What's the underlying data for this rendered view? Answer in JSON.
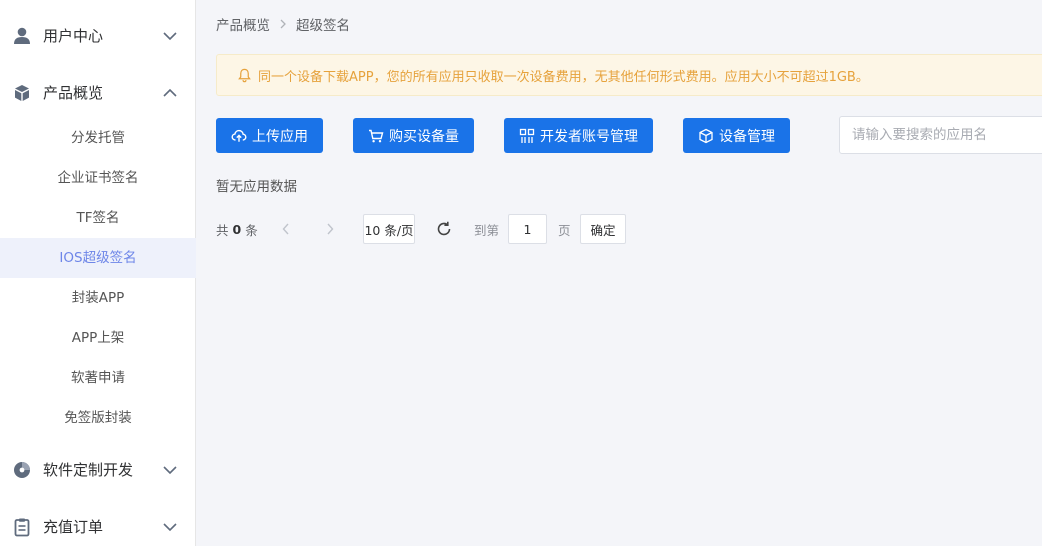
{
  "sidebar": {
    "groups": [
      {
        "label": "用户中心",
        "icon": "user-icon",
        "expanded": false
      },
      {
        "label": "产品概览",
        "icon": "cube-icon",
        "expanded": true
      },
      {
        "label": "软件定制开发",
        "icon": "pie-chart-icon",
        "expanded": false
      },
      {
        "label": "充值订单",
        "icon": "clipboard-icon",
        "expanded": false
      }
    ],
    "sub_items": [
      "分发托管",
      "企业证书签名",
      "TF签名",
      "IOS超级签名",
      "封装APP",
      "APP上架",
      "软著申请",
      "免签版封装"
    ],
    "active_item": "IOS超级签名"
  },
  "breadcrumb": {
    "parent": "产品概览",
    "current": "超级签名"
  },
  "notice": {
    "text": "同一个设备下载APP，您的所有应用只收取一次设备费用，无其他任何形式费用。应用大小不可超过1GB。"
  },
  "toolbar": {
    "upload_label": "上传应用",
    "buy_label": "购买设备量",
    "dev_account_label": "开发者账号管理",
    "device_mgmt_label": "设备管理",
    "search_placeholder": "请输入要搜索的应用名"
  },
  "empty_text": "暂无应用数据",
  "pagination": {
    "total_prefix": "共",
    "total_count": "0",
    "total_suffix": "条",
    "page_size": "10 条/页",
    "goto_label": "到第",
    "page_value": "1",
    "page_suffix": "页",
    "confirm_label": "确定"
  },
  "colors": {
    "primary": "#1a73e8",
    "active_text": "#6e86e8",
    "active_bg": "#eef1fb",
    "notice_bg": "#fdf6e6",
    "notice_text": "#e6a23c"
  }
}
